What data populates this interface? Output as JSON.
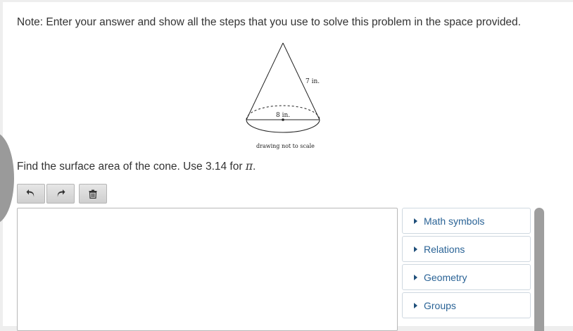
{
  "note": "Note: Enter your answer and show all the steps that you use to solve this problem in the space provided.",
  "figure": {
    "slant_label": "7 in.",
    "diameter_label": "8 in.",
    "caption": "drawing not to scale"
  },
  "question": {
    "text": "Find the surface area of the cone. Use 3.14 for ",
    "symbol": "π",
    "end": "."
  },
  "toolbar": {
    "undo_icon": "undo-icon",
    "redo_icon": "redo-icon",
    "delete_icon": "trash-icon"
  },
  "editor": {
    "value": ""
  },
  "palette": {
    "items": [
      {
        "label": "Math symbols"
      },
      {
        "label": "Relations"
      },
      {
        "label": "Geometry"
      },
      {
        "label": "Groups"
      }
    ]
  },
  "colors": {
    "link": "#2a6396",
    "background": "#eeeeee",
    "scrollbar": "#9e9e9e"
  }
}
